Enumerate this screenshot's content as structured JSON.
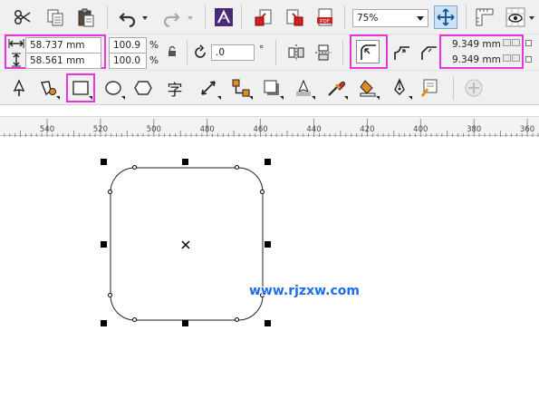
{
  "toolbar_standard": {
    "icons": [
      "scissors-icon",
      "copy-icon",
      "paste-icon",
      "undo-icon",
      "redo-icon",
      "launcher-icon",
      "import-icon",
      "export-icon",
      "publish-pdf-icon",
      "full-screen-preview-icon",
      "rulers-icon",
      "view-icon"
    ],
    "zoom_value": "75%",
    "pdf_label": "PDF"
  },
  "property_bar": {
    "width_value": "58.737 mm",
    "height_value": "58.561 mm",
    "scale_x": "100.9",
    "scale_y": "100.0",
    "percent_symbol": "%",
    "rotation_value": ".0",
    "degree_symbol": "°",
    "corner_radius_top": "9.349 mm",
    "corner_radius_bottom": "9.349 mm"
  },
  "toolbox": {
    "icons": [
      "pick-tool-icon",
      "shape-tool-icon",
      "rectangle-tool-icon",
      "ellipse-tool-icon",
      "polygon-tool-icon",
      "text-tool-icon",
      "dimension-tool-icon",
      "connector-tool-icon",
      "drop-shadow-tool-icon",
      "transparency-tool-icon",
      "eyedropper-tool-icon",
      "interactive-fill-tool-icon",
      "smart-fill-tool-icon",
      "outline-pen-icon",
      "add-tool-icon"
    ],
    "text_glyph": "字"
  },
  "ruler": {
    "labels": [
      "540",
      "520",
      "500",
      "480",
      "460",
      "440",
      "420",
      "400",
      "380",
      "360"
    ]
  },
  "canvas": {
    "watermark": "www.rjzxw.com"
  },
  "colors": {
    "highlight": "#e934d8",
    "watermark": "#1e6ee8",
    "toolbar_bg": "#f0f0f0"
  }
}
